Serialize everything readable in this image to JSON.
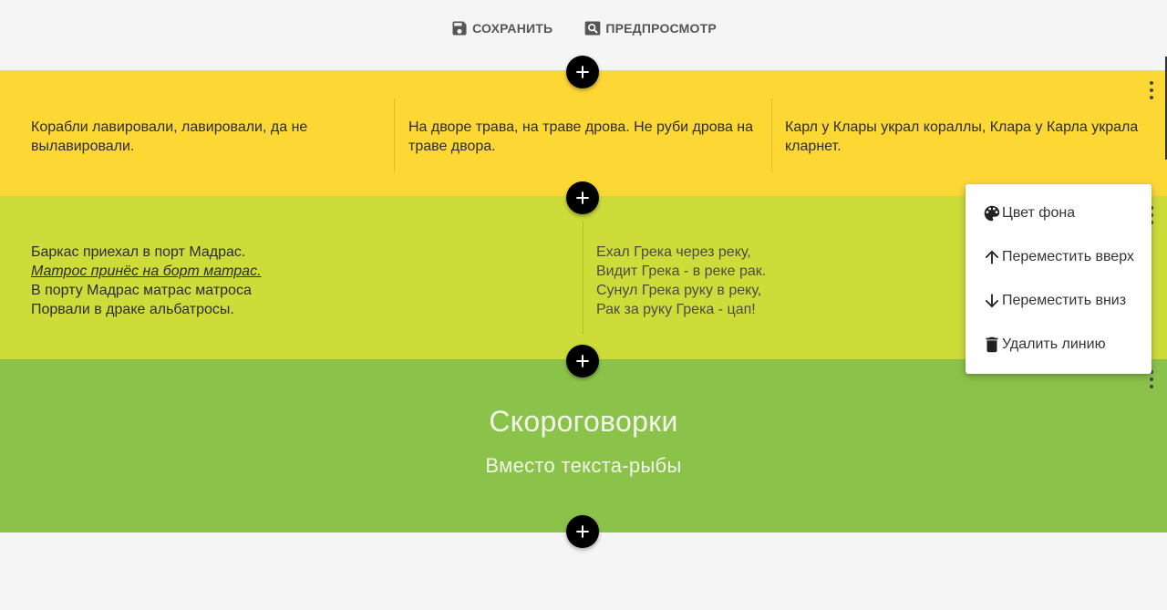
{
  "toolbar": {
    "save_label": "СОХРАНИТЬ",
    "preview_label": "ПРЕДПРОСМОТР"
  },
  "rows": [
    {
      "background": "#fdd835",
      "columns": [
        "Корабли лавировали, лавировали, да не вылавировали.",
        "На дворе трава, на траве дрова. Не руби дрова на траве двора.",
        "Карл у Клары украл кораллы, Клара у Карла украла кларнет."
      ]
    },
    {
      "background": "#cddc39",
      "left_lines": [
        "Баркас приехал в порт Мадрас.",
        "Матрос принёс на борт матрас.",
        "В порту Мадрас матрас матроса",
        "Порвали в драке альбатросы."
      ],
      "right_lines": [
        "Ехал Грека через реку,",
        "Видит Грека - в реке рак.",
        "Сунул Грека руку в реку,",
        "Рак за руку Грека - цап!"
      ]
    },
    {
      "background": "#8bc34a",
      "title": "Скороговорки",
      "subtitle": "Вместо текста-рыбы"
    }
  ],
  "context_menu": {
    "items": [
      {
        "label": "Цвет фона",
        "icon": "palette-icon"
      },
      {
        "label": "Переместить вверх",
        "icon": "arrow-up-icon"
      },
      {
        "label": "Переместить вниз",
        "icon": "arrow-down-icon"
      },
      {
        "label": "Удалить линию",
        "icon": "trash-icon"
      }
    ]
  },
  "colors": {
    "page_bg": "#f5f5f5",
    "add_button": "#000000",
    "accent_text": "#555555"
  }
}
